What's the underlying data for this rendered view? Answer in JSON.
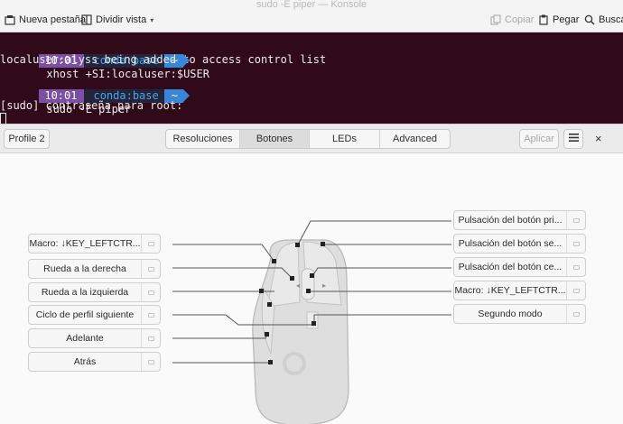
{
  "konsole": {
    "window_title": "sudo -E piper — Konsole",
    "toolbar": {
      "new_tab": "Nueva pestaña",
      "split_view": "Dividir vista",
      "copy": "Copiar",
      "paste": "Pegar",
      "search": "Buscar"
    },
    "terminal": {
      "prompt1": {
        "time": "10:01",
        "env": "conda:base",
        "dir": "~",
        "command": "xhost +SI:localuser:$USER"
      },
      "output1": "localuser:alyss being added to access control list",
      "prompt2": {
        "time": "10:01",
        "env": "conda:base",
        "dir": "~",
        "command": "sudo -E piper"
      },
      "output2": "[sudo] contraseña para root:"
    }
  },
  "piper": {
    "profile_button": "Profile 2",
    "tabs": [
      "Resoluciones",
      "Botones",
      "LEDs",
      "Advanced"
    ],
    "active_tab": "Botones",
    "apply_button": "Aplicar",
    "close_label": "×",
    "left_buttons": [
      "Macro: ↓KEY_LEFTCTR...",
      "Rueda a la derecha",
      "Rueda a la izquierda",
      "Ciclo de perfil siguiente",
      "Adelante",
      "Atrás"
    ],
    "right_buttons": [
      "Pulsación del botón pri...",
      "Pulsación del botón se...",
      "Pulsación del botón ce...",
      "Macro: ↓KEY_LEFTCTR...",
      "Segundo modo"
    ],
    "colors": {
      "mouse_fill": "#dedede",
      "mouse_stroke": "#b9b9b9",
      "leader_line": "#555555"
    }
  }
}
